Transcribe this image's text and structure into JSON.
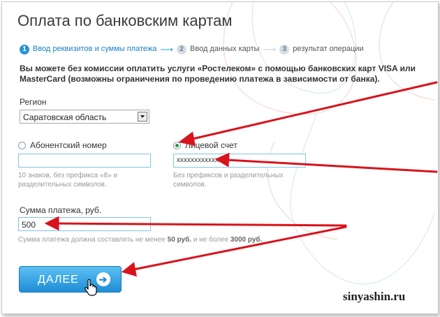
{
  "page": {
    "title": "Оплата по банковским картам",
    "info_text": "Вы можете без комиссии оплатить услуги «Ростелеком» с помощью банковских карт VISA или MasterCard (возможны ограничения по проведению платежа в зависимости от банка).",
    "watermark": "sinyashin.ru"
  },
  "steps": [
    {
      "number": "1",
      "label": "Ввод реквизитов и суммы платежа",
      "active": true
    },
    {
      "number": "2",
      "label": "Ввод данных карты",
      "active": false
    },
    {
      "number": "3",
      "label": "результат операции",
      "active": false
    }
  ],
  "step_arrow": "⟶",
  "region": {
    "label": "Регион",
    "selected": "Саратовская область"
  },
  "account_type": {
    "subscriber": {
      "label": "Абонентский номер",
      "value": "",
      "checked": false,
      "hint_line1": "10 знаков, без префикса «8» и",
      "hint_line2": "разделительных символов."
    },
    "personal": {
      "label": "Лицевой счет",
      "value": "xxxxxxxxxxxxxx",
      "checked": true,
      "hint_line1": "Без префиксов и разделительных",
      "hint_line2": "символов."
    }
  },
  "amount": {
    "label": "Сумма платежа, руб.",
    "value": "500",
    "hint_prefix": "Сумма платежа должна составлять не менее ",
    "hint_min": "50 руб.",
    "hint_middle": " и не более ",
    "hint_max": "3000 руб."
  },
  "submit": {
    "label": "ДАЛЕЕ",
    "icon": "arrow-right-icon",
    "color": "#2a93d5"
  },
  "annotation_color": "#d9121b",
  "active_step_color": "#2a93d5"
}
